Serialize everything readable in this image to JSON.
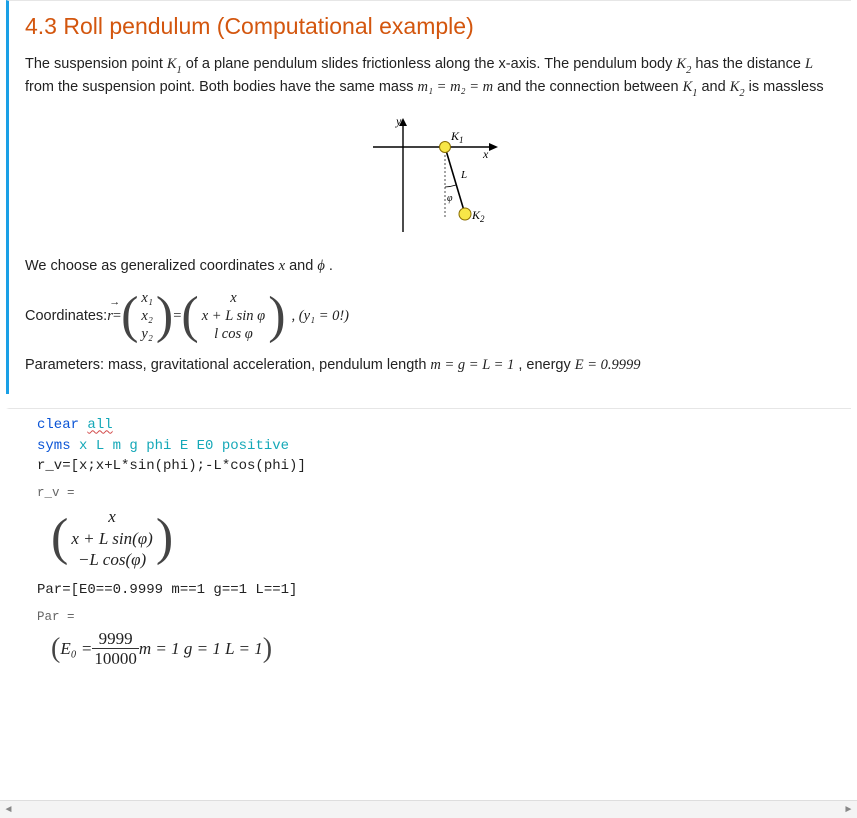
{
  "section": {
    "title": "4.3 Roll pendulum (Computational example)",
    "para1_a": "The suspension point ",
    "K1": "K",
    "K1_sub": "1",
    "para1_b": " of a plane pendulum slides frictionless along the x-axis. The pendulum body ",
    "K2": "K",
    "K2_sub": "2",
    "para1_c": " has the distance ",
    "L": "L",
    "para1_d": " from the suspension point. Both bodies have the same mass ",
    "mass_eq": "m₁ = m₂ = m",
    "para1_e": " and the connection between ",
    "para1_f": " and ",
    "para1_g": " is massless"
  },
  "figure": {
    "y_label": "y",
    "x_label": "x",
    "K1_label": "K₁",
    "K2_label": "K₂",
    "L_label": "L",
    "phi_label": "φ"
  },
  "gen_coords": {
    "intro_a": "We choose as generalized coordinates ",
    "x": "x",
    "intro_b": " and ",
    "phi": "ϕ",
    "intro_c": " ."
  },
  "coords_line": {
    "label": "Coordinates:  ",
    "r": "r",
    "eq": " = ",
    "v1_1": "x₁",
    "v1_2": "x₂",
    "v1_3": "y₂",
    "v2_1": "x",
    "v2_2": "x + L sin φ",
    "v2_3": "l cos φ",
    "tail": ",    (y₁ = 0!)"
  },
  "params_line": {
    "a": "Parameters: mass, gravitational acceleration, pendulum length ",
    "eq": "m = g = L = 1",
    "b": ", energy ",
    "E": "E = 0.9999"
  },
  "code": {
    "l1_kw": "clear ",
    "l1_arg": "all",
    "l2_kw": "syms ",
    "l2_args": "x L m g phi E E0 positive",
    "l3": "r_v=[x;x+L*sin(phi);-L*cos(phi)]",
    "l4": "Par=[E0==0.9999 m==1 g==1 L==1]"
  },
  "out1": {
    "label": "r_v =",
    "r1": "x",
    "r2": "x + L sin(φ)",
    "r3": "−L cos(φ)"
  },
  "out2": {
    "label": "Par =",
    "e0_lhs": "E₀ = ",
    "e0_num": "9999",
    "e0_den": "10000",
    "rest": "   m = 1   g = 1   L = 1"
  },
  "scrollbar": {
    "left": "◄",
    "right": "►"
  }
}
